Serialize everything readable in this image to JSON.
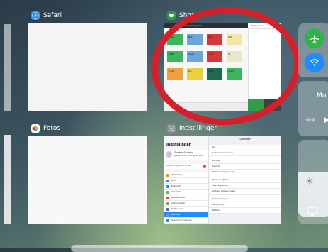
{
  "cards": {
    "safari": {
      "title": "Safari"
    },
    "shoplist": {
      "title": "Shop",
      "header": "Shoppingliste 1",
      "right_header": "Ekstra varer",
      "tiles": [
        {
          "label": "Mælk",
          "color": "#3cb55d"
        },
        {
          "label": "Brød",
          "color": "#6aa6d9"
        },
        {
          "label": "Æg",
          "color": "#d23a3a"
        },
        {
          "label": "Ost",
          "color": "#f0e7a6"
        },
        {
          "label": "Kaffe",
          "color": "#3cb55d"
        },
        {
          "label": "Smør",
          "color": "#6aa6d9"
        },
        {
          "label": "Juice",
          "color": "#d23a3a"
        },
        {
          "label": "Te",
          "color": "#e8e8c8"
        },
        {
          "label": "Frugt",
          "color": "#f0a040"
        },
        {
          "label": "Ris",
          "color": "#e8d040"
        },
        {
          "label": "Pasta",
          "color": "#1f6a52"
        },
        {
          "label": "Salat",
          "color": "#3cb55d"
        }
      ]
    },
    "fotos": {
      "title": "Fotos"
    },
    "indstillinger": {
      "title": "Indstillinger",
      "left_title": "Indstillinger",
      "profile_name": "Shaber Shaber",
      "profile_sub": "Apple-id, iCloud, iTunes og App Store",
      "banner": "Afslut konfiguration af iPad",
      "right_title": "Generelt",
      "left_rows": [
        "Flytilstand",
        "Wi-Fi",
        "Bluetooth",
        "Mobildata",
        "Notifikationer",
        "Kontrolcenter",
        "Forstyr ikke",
        "Generelt",
        "Skærm og lysstyrke"
      ],
      "right_rows": [
        "Om",
        "Softwareopdatering",
        "AirDrop",
        "Handoff",
        "Multitasking og Dock",
        "Tilgængelighed",
        "iPad-lagerplads",
        "Opdater i baggrunden",
        "Begrænsninger",
        "Dato og tid",
        "Tastatur"
      ]
    }
  },
  "control_center": {
    "music_label": "Mu",
    "colors": {
      "airplane": "#31b24a",
      "wifi": "#1f8cff"
    }
  }
}
